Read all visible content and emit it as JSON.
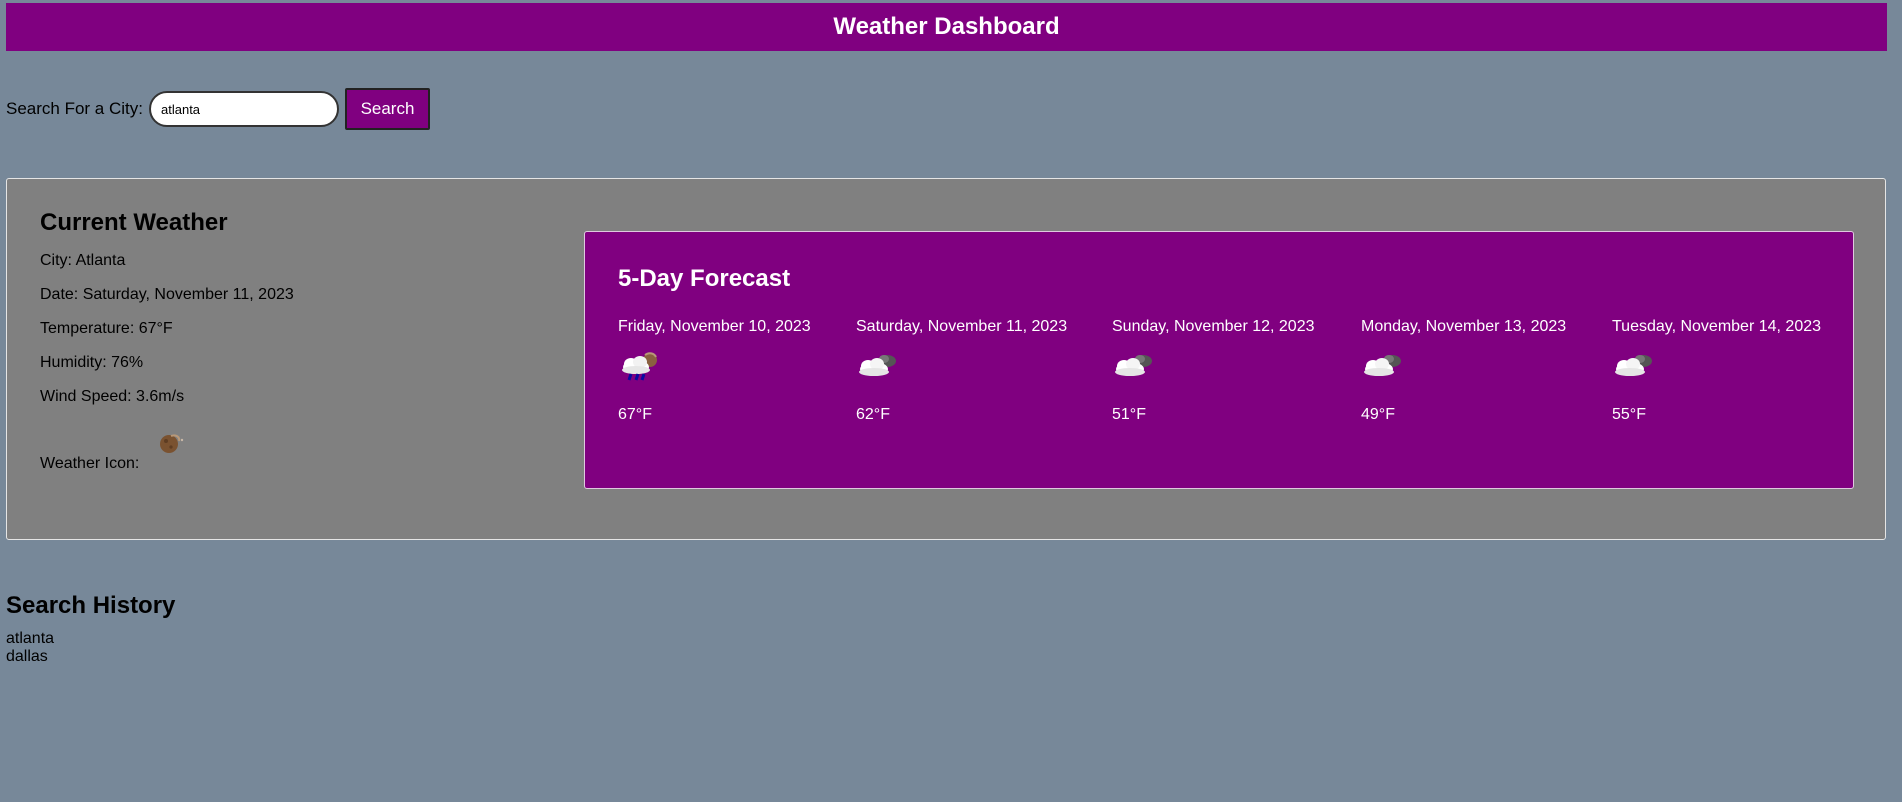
{
  "header": {
    "title": "Weather Dashboard"
  },
  "search": {
    "label": "Search For a City:",
    "value": "atlanta",
    "button_label": "Search"
  },
  "current": {
    "heading": "Current Weather",
    "city": "City: Atlanta",
    "date": "Date: Saturday, November 11, 2023",
    "temperature": "Temperature: 67°F",
    "humidity": "Humidity: 76%",
    "wind": "Wind Speed: 3.6m/s",
    "icon_label": "Weather Icon:",
    "icon": "night-moon-icon"
  },
  "forecast": {
    "heading": "5-Day Forecast",
    "days": [
      {
        "date": "Friday, November 10, 2023",
        "icon": "night-rain-cloud-icon",
        "temp": "67°F"
      },
      {
        "date": "Saturday, November 11, 2023",
        "icon": "night-cloud-icon",
        "temp": "62°F"
      },
      {
        "date": "Sunday, November 12, 2023",
        "icon": "night-cloud-icon",
        "temp": "51°F"
      },
      {
        "date": "Monday, November 13, 2023",
        "icon": "night-cloud-icon",
        "temp": "49°F"
      },
      {
        "date": "Tuesday, November 14, 2023",
        "icon": "night-cloud-icon",
        "temp": "55°F"
      }
    ]
  },
  "history": {
    "heading": "Search History",
    "items": [
      "atlanta",
      "dallas"
    ]
  },
  "colors": {
    "background": "#778899",
    "accent": "#800080",
    "panel": "#808080"
  }
}
